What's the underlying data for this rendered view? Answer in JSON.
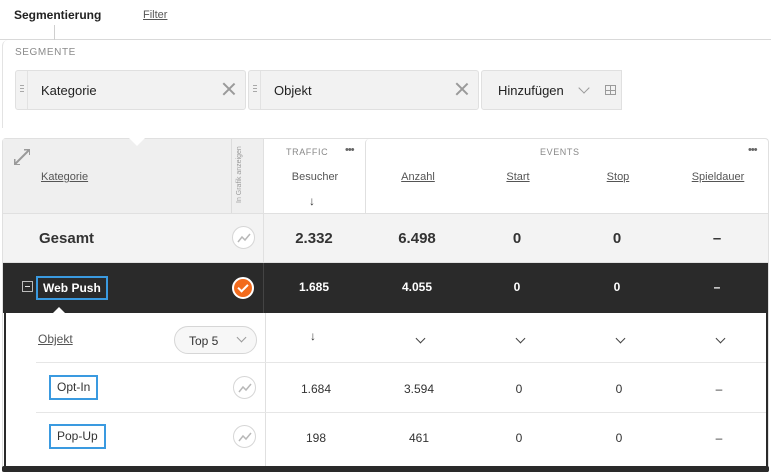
{
  "tabs": {
    "active": "Segmentierung",
    "filter": "Filter"
  },
  "segments": {
    "title": "SEGMENTE",
    "chips": [
      "Kategorie",
      "Objekt"
    ],
    "add_label": "Hinzufügen"
  },
  "table": {
    "header": {
      "category_link": "Kategorie",
      "in_grafik": "In Grafik anzeigen",
      "traffic_group": "TRAFFIC",
      "events_group": "EVENTS",
      "columns": [
        "Besucher",
        "Anzahl",
        "Start",
        "Stop",
        "Spieldauer"
      ],
      "sort_arrow": "↓"
    },
    "total_row": {
      "name": "Gesamt",
      "values": [
        "2.332",
        "6.498",
        "0",
        "0",
        "–"
      ]
    },
    "group_row": {
      "name": "Web Push",
      "values": [
        "1.685",
        "4.055",
        "0",
        "0",
        "–"
      ]
    },
    "sub": {
      "segment_link": "Objekt",
      "top_select": "Top 5",
      "rows": [
        {
          "name": "Opt-In",
          "values": [
            "1.684",
            "3.594",
            "0",
            "0",
            "–"
          ]
        },
        {
          "name": "Pop-Up",
          "values": [
            "198",
            "461",
            "0",
            "0",
            "–"
          ]
        }
      ]
    }
  },
  "colors": {
    "accent": "#f26b1d",
    "highlight": "#3a9ae0",
    "dark_row": "#2a2a2a"
  }
}
